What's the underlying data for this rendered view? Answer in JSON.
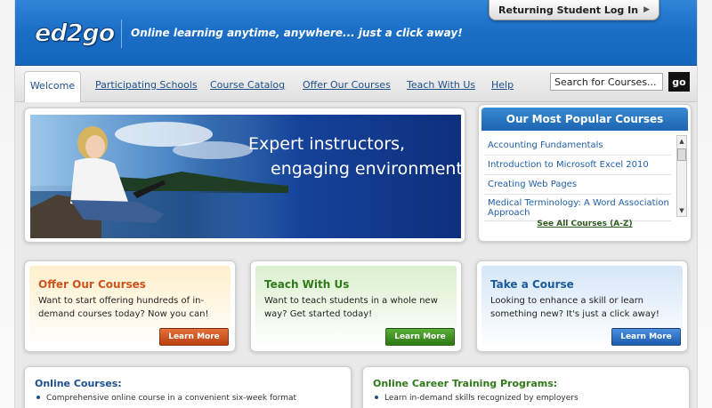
{
  "header": {
    "logo_text": "ed2go",
    "tagline": "Online learning anytime, anywhere... just a click away!",
    "login_label": "Returning Student Log In"
  },
  "nav": {
    "tabs": [
      {
        "label": "Welcome",
        "active": true
      },
      {
        "label": "Participating Schools"
      },
      {
        "label": "Course Catalog"
      },
      {
        "label": "Offer Our Courses"
      },
      {
        "label": "Teach With Us"
      },
      {
        "label": "Help"
      }
    ],
    "search_value": "Search for Courses...",
    "go_label": "go"
  },
  "hero": {
    "line1": "Expert instructors,",
    "line2": "engaging environment"
  },
  "popular": {
    "title": "Our Most Popular Courses",
    "items": [
      "Accounting Fundamentals",
      "Introduction to Microsoft Excel 2010",
      "Creating Web Pages",
      "Medical Terminology: A Word Association Approach"
    ],
    "see_all": "See All Courses (A-Z)"
  },
  "promos": [
    {
      "title": "Offer Our Courses",
      "text": "Want to start offering hundreds of in-demand courses today? Now you can!",
      "button": "Learn More",
      "color": "#d0531c"
    },
    {
      "title": "Teach With Us",
      "text": "Want to teach students in a whole new way? Get started today!",
      "button": "Learn More",
      "color": "#3c8f22"
    },
    {
      "title": "Take a Course",
      "text": "Looking to enhance a skill or learn something new? It's just a click away!",
      "button": "Learn More",
      "color": "#2a70c4"
    }
  ],
  "bottom": {
    "online_title": "Online Courses:",
    "online_item": "Comprehensive online course in a convenient six-week format",
    "career_title": "Online Career Training Programs:",
    "career_item": "Learn in-demand skills recognized by employers"
  },
  "colors": {
    "header_blue": "#1c6fc6",
    "link_blue": "#2160a8",
    "offer_orange": "#d0531c",
    "teach_green": "#3c8f22",
    "take_blue": "#2a70c4"
  }
}
